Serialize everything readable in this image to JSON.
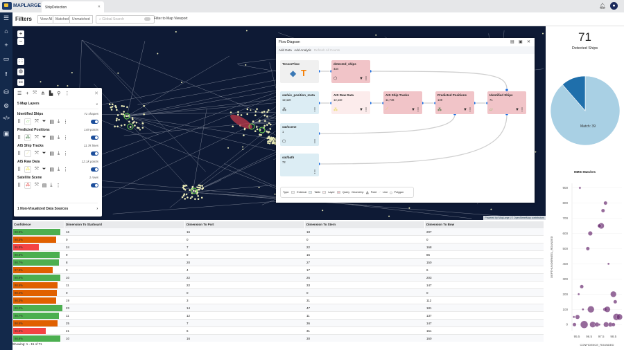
{
  "app": {
    "logo": "MAPLARGE",
    "tab": "ShipDetection"
  },
  "filters": {
    "title": "Filters",
    "view_all": "View All",
    "matched": "Matched",
    "unmatched": "Unmatched",
    "search_placeholder": "Global Search",
    "viewport_toggle": "Filter to Map Viewport"
  },
  "map": {
    "attribution": "Powered by MapLarge | © OpenStreetMap contributors"
  },
  "layers": {
    "header": "5 Map Layers",
    "items": [
      {
        "name": "Identified Ships",
        "count": "71 shapes",
        "color": "#7bd35a",
        "geom": "polygon"
      },
      {
        "name": "Predicted Positions",
        "count": "149 points",
        "color": "#1b5e20",
        "geom": "point"
      },
      {
        "name": "AIS Ship Tracks",
        "count": "11.7k lines",
        "color": "#e7e27a",
        "geom": "line"
      },
      {
        "name": "AIS Raw Data",
        "count": "12.1k points",
        "color": "#f0e44a",
        "geom": "point"
      },
      {
        "name": "Satellite Scene",
        "count": "1 rows",
        "color": "#e53935",
        "geom": "point"
      }
    ],
    "nonvisualized": "1 Non-Visualized Data Sources"
  },
  "flow": {
    "title": "Flow Diagram",
    "add_data": "Add Data",
    "add_analytic": "Add Analytic",
    "refresh": "Refresh All Counts",
    "nodes": [
      {
        "name": "TensorFlow",
        "count": ""
      },
      {
        "name": "detected_ships",
        "count": "434"
      },
      {
        "name": "sat/ais_position_meta",
        "count": "12,110"
      },
      {
        "name": "AIS Raw Data",
        "count": "12,110"
      },
      {
        "name": "AIS Ship Tracks",
        "count": "11,746"
      },
      {
        "name": "Predicted Positions",
        "count": "149"
      },
      {
        "name": "Identified Ships",
        "count": "71"
      },
      {
        "name": "sat/scene",
        "count": "1"
      },
      {
        "name": "sat/bath",
        "count": "72"
      }
    ],
    "legend": {
      "type": "Type:",
      "external": "External",
      "table": "Table",
      "layer": "Layer",
      "query": "Query",
      "geometry": "Geometry:",
      "point": "Point",
      "line": "Line",
      "polygon": "Polygon"
    }
  },
  "table": {
    "columns": [
      "Confidence",
      "Dimension To Starboard",
      "Dimension To Port",
      "Dimension To Stern",
      "Dimension To Bow"
    ],
    "rows": [
      [
        "98.9%",
        "16",
        "16",
        "18",
        "207"
      ],
      [
        "98.3%",
        "0",
        "0",
        "0",
        "0"
      ],
      [
        "95.8%",
        "24",
        "7",
        "22",
        "168"
      ],
      [
        "98.8%",
        "9",
        "9",
        "16",
        "86"
      ],
      [
        "98.7%",
        "8",
        "20",
        "27",
        "150"
      ],
      [
        "97.8%",
        "3",
        "4",
        "17",
        "6"
      ],
      [
        "98.9%",
        "10",
        "22",
        "26",
        "203"
      ],
      [
        "98.5%",
        "11",
        "22",
        "33",
        "147"
      ],
      [
        "98.4%",
        "0",
        "0",
        "0",
        "0"
      ],
      [
        "98.3%",
        "19",
        "3",
        "31",
        "112"
      ],
      [
        "99.2%",
        "23",
        "14",
        "47",
        "181"
      ],
      [
        "98.7%",
        "11",
        "12",
        "11",
        "137"
      ],
      [
        "98.5%",
        "25",
        "7",
        "36",
        "147"
      ],
      [
        "96.8%",
        "21",
        "6",
        "31",
        "151"
      ],
      [
        "98.9%",
        "10",
        "16",
        "30",
        "160"
      ]
    ],
    "showing": "Showing: 1 - 15 of 71"
  },
  "summary": {
    "count": "71",
    "label": "Detected Ships"
  },
  "colors": {
    "high": "#4caf50",
    "mid": "#e06000",
    "low": "#f44343",
    "navy": "#13294b",
    "pie_light": "#a9d0e4",
    "pie_dark": "#1f6fab",
    "bubble": "#6a2c70"
  },
  "chart_data": [
    {
      "type": "pie",
      "title": "",
      "labels": [
        "Match",
        "Other"
      ],
      "values": [
        39,
        5
      ],
      "shown_label": "Match: 39"
    },
    {
      "type": "scatter",
      "title": "MMSI Matches",
      "xlabel": "CONFIDENCE_ROUNDED",
      "ylabel": "DEPTHUNDERKEEL_ROUNDED",
      "xticks": [
        "95.5",
        "96.5",
        "97.5",
        "98.5"
      ],
      "yticks": [
        "0",
        "100",
        "200",
        "300",
        "400",
        "500",
        "600",
        "700",
        "800",
        "900"
      ],
      "xlim": [
        95.1,
        99.2
      ],
      "ylim": [
        -40,
        930
      ],
      "points": [
        [
          95.75,
          900,
          1
        ],
        [
          97.85,
          800,
          3
        ],
        [
          97.65,
          750,
          3
        ],
        [
          97.5,
          650,
          6
        ],
        [
          97.35,
          650,
          3
        ],
        [
          96.6,
          600,
          4
        ],
        [
          96.4,
          500,
          3
        ],
        [
          98.1,
          400,
          1
        ],
        [
          95.9,
          250,
          3
        ],
        [
          95.65,
          200,
          1
        ],
        [
          98.5,
          200,
          6
        ],
        [
          98.65,
          150,
          3
        ],
        [
          96.0,
          100,
          1
        ],
        [
          96.65,
          100,
          7
        ],
        [
          97.8,
          100,
          3
        ],
        [
          98.0,
          100,
          6
        ],
        [
          95.25,
          50,
          1
        ],
        [
          95.55,
          50,
          4
        ],
        [
          98.75,
          50,
          7
        ],
        [
          99.0,
          50,
          6
        ],
        [
          95.3,
          0,
          3
        ],
        [
          96.1,
          0,
          8
        ],
        [
          96.8,
          0,
          6
        ],
        [
          97.15,
          0,
          4
        ],
        [
          97.35,
          0,
          1
        ],
        [
          97.9,
          0,
          5
        ],
        [
          98.25,
          0,
          4
        ],
        [
          98.5,
          0,
          3
        ]
      ]
    }
  ]
}
